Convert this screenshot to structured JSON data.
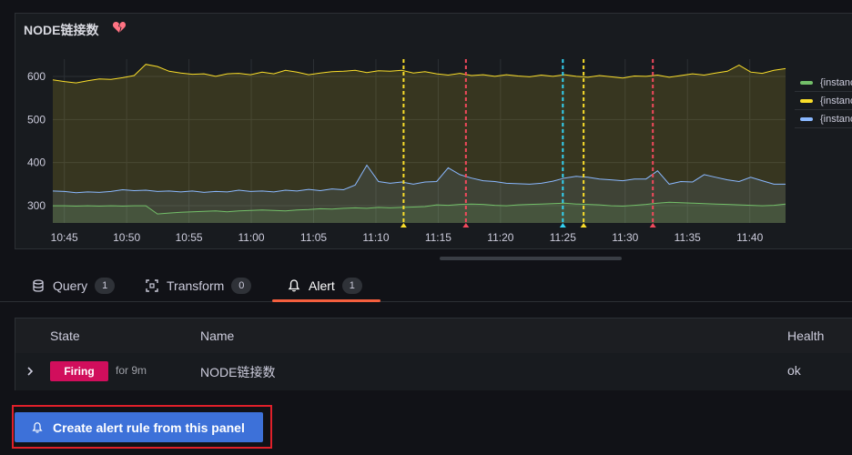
{
  "panel": {
    "title": "NODE链接数"
  },
  "legend": [
    {
      "label": "{instance",
      "color": "#73bf69"
    },
    {
      "label": "{instance",
      "color": "#fade2a"
    },
    {
      "label": "{instance",
      "color": "#8ab8ff"
    }
  ],
  "chart_data": {
    "type": "area",
    "x": [
      "10:45",
      "10:50",
      "10:55",
      "11:00",
      "11:05",
      "11:10",
      "11:15",
      "11:20",
      "11:25",
      "11:30",
      "11:35",
      "11:40"
    ],
    "yticks": [
      300,
      400,
      500,
      600
    ],
    "ylim": [
      260,
      640
    ],
    "x_range": [
      0,
      63.5
    ],
    "series": [
      {
        "color": "#fade2a",
        "values": [
          592,
          588,
          585,
          590,
          594,
          593,
          597,
          602,
          628,
          623,
          612,
          608,
          605,
          606,
          600,
          606,
          607,
          604,
          610,
          606,
          614,
          610,
          604,
          608,
          611,
          612,
          614,
          609,
          613,
          612,
          614,
          608,
          611,
          606,
          603,
          607,
          602,
          604,
          600,
          604,
          601,
          599,
          603,
          600,
          604,
          600,
          598,
          602,
          599,
          596,
          601,
          600,
          603,
          598,
          602,
          606,
          603,
          608,
          612,
          626,
          610,
          607,
          614,
          618
        ]
      },
      {
        "color": "#8ab8ff",
        "values": [
          334,
          333,
          330,
          332,
          331,
          333,
          337,
          335,
          336,
          333,
          334,
          332,
          334,
          331,
          333,
          332,
          336,
          333,
          334,
          332,
          336,
          334,
          338,
          335,
          339,
          337,
          348,
          394,
          356,
          352,
          355,
          350,
          355,
          356,
          388,
          372,
          364,
          358,
          356,
          352,
          351,
          350,
          352,
          357,
          364,
          368,
          366,
          362,
          360,
          358,
          362,
          362,
          381,
          350,
          356,
          355,
          372,
          366,
          360,
          356,
          366,
          358,
          350,
          350
        ]
      },
      {
        "color": "#73bf69",
        "values": [
          300,
          300,
          299,
          300,
          299,
          300,
          299,
          300,
          300,
          281,
          283,
          285,
          286,
          287,
          288,
          286,
          288,
          289,
          290,
          289,
          288,
          290,
          291,
          293,
          292,
          294,
          295,
          294,
          296,
          295,
          296,
          297,
          298,
          302,
          301,
          303,
          304,
          303,
          301,
          300,
          302,
          303,
          304,
          305,
          306,
          304,
          303,
          302,
          300,
          299,
          301,
          303,
          306,
          308,
          307,
          306,
          305,
          304,
          303,
          302,
          301,
          300,
          301,
          304
        ]
      }
    ],
    "annotations": [
      {
        "x": 11.24,
        "color": "#fade2a"
      },
      {
        "x": 11.33,
        "color": "#f2495c"
      },
      {
        "x": 11.47,
        "color": "#33d2f2"
      },
      {
        "x": 11.5,
        "color": "#fade2a"
      },
      {
        "x": 11.6,
        "color": "#f2495c"
      }
    ]
  },
  "tabs": [
    {
      "label": "Query",
      "count": "1",
      "icon": "database-icon"
    },
    {
      "label": "Transform",
      "count": "0",
      "icon": "transform-icon"
    },
    {
      "label": "Alert",
      "count": "1",
      "icon": "bell-icon"
    }
  ],
  "table": {
    "headers": {
      "state": "State",
      "name": "Name",
      "health": "Health"
    },
    "row": {
      "state": "Firing",
      "for": "for 9m",
      "name": "NODE链接数",
      "health": "ok"
    }
  },
  "create_button": {
    "label": "Create alert rule from this panel"
  }
}
